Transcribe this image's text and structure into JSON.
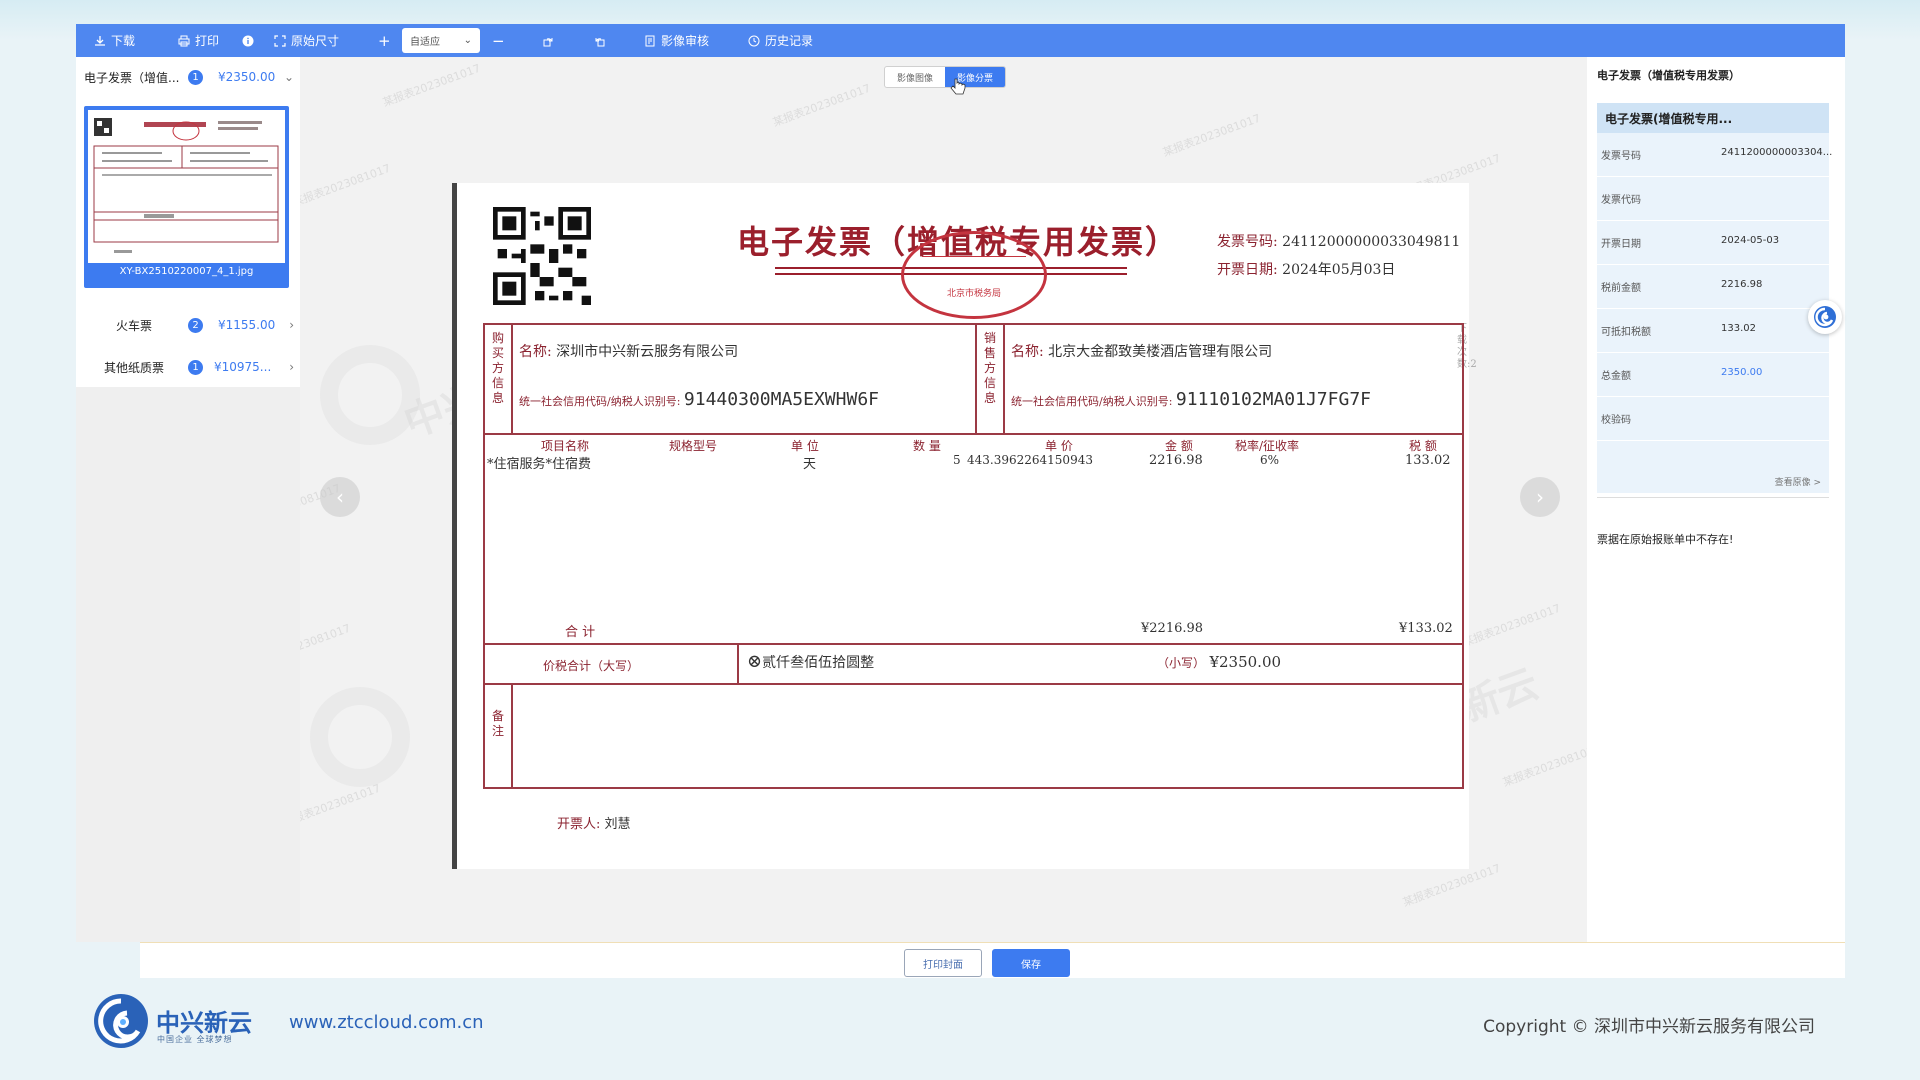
{
  "toolbar": {
    "download": "下载",
    "print": "打印",
    "original_size": "原始尺寸",
    "zoom_in": "+",
    "zoom_value": "自适应",
    "zoom_out": "−",
    "image_review": "影像审核",
    "history": "历史记录"
  },
  "categories": [
    {
      "title": "电子发票（增值...",
      "count": "1",
      "amount": "¥2350.00",
      "chev": "⌄"
    },
    {
      "title": "火车票",
      "count": "2",
      "amount": "¥1155.00",
      "chev": "›"
    },
    {
      "title": "其他纸质票",
      "count": "1",
      "amount": "¥10975...",
      "chev": "›"
    }
  ],
  "thumbnail": {
    "filename": "XY-BX2510220007_4_1.jpg"
  },
  "view_tabs": [
    "影像图像",
    "影像分票"
  ],
  "watermark_text": "某报表2023081017",
  "brand_watermark": "中兴新云",
  "invoice": {
    "title": "电子发票（增值税专用发票）",
    "seal_text": "北京市税务局",
    "number_label": "发票号码:",
    "number": "24112000000033049811",
    "date_label": "开票日期:",
    "date": "2024年05月03日",
    "buyer_vlabel": "购买方信息",
    "seller_vlabel": "销售方信息",
    "buyer_name_label": "名称:",
    "buyer_name": "深圳市中兴新云服务有限公司",
    "buyer_tax_label": "统一社会信用代码/纳税人识别号:",
    "buyer_tax_id": "91440300MA5EXWHW6F",
    "seller_name_label": "名称:",
    "seller_name": "北京大金都致美楼酒店管理有限公司",
    "seller_tax_label": "统一社会信用代码/纳税人识别号:",
    "seller_tax_id": "91110102MA01J7FG7F",
    "columns": [
      "项目名称",
      "规格型号",
      "单 位",
      "数 量",
      "单 价",
      "金 额",
      "税率/征收率",
      "税 额"
    ],
    "item": {
      "name": "*住宿服务*住宿费",
      "unit": "天",
      "qty": "5",
      "price": "443.3962264150943",
      "amount": "2216.98",
      "rate": "6%",
      "tax": "133.02"
    },
    "total_label": "合 计",
    "total_amount": "¥2216.98",
    "total_tax": "¥133.02",
    "grand_label": "价税合计（大写）",
    "grand_upper": "贰仟叁佰伍拾圆整",
    "grand_lower_label": "（小写）",
    "grand_lower": "¥2350.00",
    "remarks_vlabel": "备注",
    "drawer_label": "开票人:",
    "drawer": "刘慧",
    "side_note": "下载次数:2"
  },
  "right_panel": {
    "title": "电子发票（增值税专用发票）",
    "card_title": "电子发票(增值税专用...",
    "rows": [
      {
        "k": "发票号码",
        "v": "2411200000003304..."
      },
      {
        "k": "发票代码",
        "v": ""
      },
      {
        "k": "开票日期",
        "v": "2024-05-03"
      },
      {
        "k": "税前金额",
        "v": "2216.98"
      },
      {
        "k": "可抵扣税额",
        "v": "133.02"
      },
      {
        "k": "总金额",
        "v": "2350.00"
      },
      {
        "k": "校验码",
        "v": ""
      }
    ],
    "view_original": "查看原像 >",
    "note": "票据在原始报账单中不存在!"
  },
  "bottom": {
    "print_cover": "打印封面",
    "save": "保存"
  },
  "footer": {
    "brand": "中兴新云",
    "slogan": "中国企业 全球梦想",
    "url": "www.ztccloud.com.cn",
    "copyright": "Copyright © 深圳市中兴新云服务有限公司"
  },
  "colors": {
    "accent": "#3d7bf0",
    "toolbar": "#4f87f0",
    "invoice_red": "#9b1f2c"
  }
}
